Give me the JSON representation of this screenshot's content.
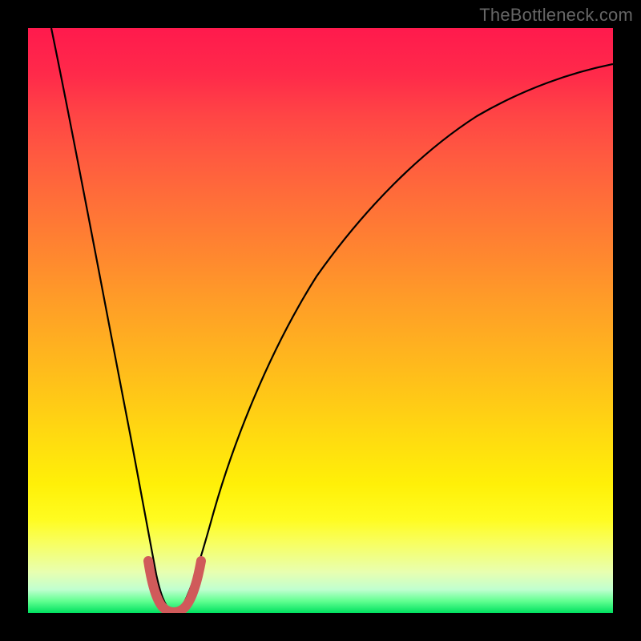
{
  "watermark": "TheBottleneck.com",
  "chart_data": {
    "type": "line",
    "title": "",
    "xlabel": "",
    "ylabel": "",
    "xlim": [
      0,
      100
    ],
    "ylim": [
      0,
      100
    ],
    "grid": false,
    "series": [
      {
        "name": "bottleneck-curve",
        "x": [
          4,
          8,
          12,
          15,
          17,
          19,
          20,
          22,
          23.5,
          25,
          27,
          30,
          35,
          40,
          48,
          56,
          64,
          72,
          80,
          88,
          96,
          100
        ],
        "y": [
          100,
          80,
          58,
          38,
          25,
          12,
          5,
          1,
          0,
          1,
          6,
          14,
          28,
          40,
          54,
          64,
          72,
          78,
          83,
          87,
          90,
          92
        ]
      },
      {
        "name": "valley-highlight",
        "x": [
          19.5,
          21,
          22.5,
          24,
          25.5,
          27
        ],
        "y": [
          8,
          2,
          0,
          0,
          2,
          8
        ]
      }
    ],
    "background_gradient": {
      "top": "#ff1a4d",
      "mid": "#fff008",
      "bottom": "#00e060"
    }
  }
}
